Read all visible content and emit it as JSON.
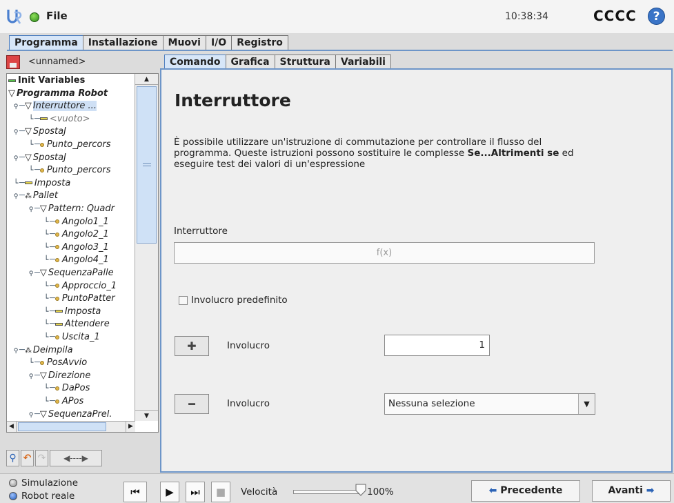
{
  "topbar": {
    "file_label": "File",
    "clock": "10:38:34",
    "robot_name": "CCCC",
    "help_glyph": "?"
  },
  "main_tabs": [
    "Programma",
    "Installazione",
    "Muovi",
    "I/O",
    "Registro"
  ],
  "main_tab_active": "Programma",
  "program": {
    "file_name": "<unnamed>",
    "tree": [
      {
        "label": "Init Variables",
        "indent": 0,
        "glyph": "bar-green",
        "style": "bold"
      },
      {
        "label": "Programma Robot",
        "indent": 0,
        "glyph": "triangle",
        "style": "boldital"
      },
      {
        "label": "Interruttore ...",
        "indent": 1,
        "glyph": "triangle",
        "style": "selected"
      },
      {
        "label": "<vuoto>",
        "indent": 2,
        "glyph": "bar",
        "style": "muted"
      },
      {
        "label": "SpostaJ",
        "indent": 1,
        "glyph": "triangle",
        "style": ""
      },
      {
        "label": "Punto_percors",
        "indent": 2,
        "glyph": "dot",
        "style": ""
      },
      {
        "label": "SpostaJ",
        "indent": 1,
        "glyph": "triangle",
        "style": ""
      },
      {
        "label": "Punto_percors",
        "indent": 2,
        "glyph": "dot",
        "style": ""
      },
      {
        "label": "Imposta",
        "indent": 1,
        "glyph": "bar",
        "style": ""
      },
      {
        "label": "Pallet",
        "indent": 1,
        "glyph": "pallet",
        "style": ""
      },
      {
        "label": "Pattern: Quadr",
        "indent": 2,
        "glyph": "triangle",
        "style": ""
      },
      {
        "label": "Angolo1_1",
        "indent": 3,
        "glyph": "dot",
        "style": ""
      },
      {
        "label": "Angolo2_1",
        "indent": 3,
        "glyph": "dot",
        "style": ""
      },
      {
        "label": "Angolo3_1",
        "indent": 3,
        "glyph": "dot",
        "style": ""
      },
      {
        "label": "Angolo4_1",
        "indent": 3,
        "glyph": "dot",
        "style": ""
      },
      {
        "label": "SequenzaPalle",
        "indent": 2,
        "glyph": "triangle",
        "style": ""
      },
      {
        "label": "Approccio_1",
        "indent": 3,
        "glyph": "dot",
        "style": ""
      },
      {
        "label": "PuntoPatter",
        "indent": 3,
        "glyph": "dot",
        "style": ""
      },
      {
        "label": "Imposta",
        "indent": 3,
        "glyph": "bar",
        "style": ""
      },
      {
        "label": "Attendere",
        "indent": 3,
        "glyph": "bar",
        "style": ""
      },
      {
        "label": "Uscita_1",
        "indent": 3,
        "glyph": "dot",
        "style": ""
      },
      {
        "label": "Deimpila",
        "indent": 1,
        "glyph": "pallet",
        "style": ""
      },
      {
        "label": "PosAvvio",
        "indent": 2,
        "glyph": "dot",
        "style": ""
      },
      {
        "label": "Direzione",
        "indent": 2,
        "glyph": "triangle",
        "style": ""
      },
      {
        "label": "DaPos",
        "indent": 3,
        "glyph": "dot",
        "style": ""
      },
      {
        "label": "APos",
        "indent": 3,
        "glyph": "dot",
        "style": ""
      },
      {
        "label": "SequenzaPrel.",
        "indent": 2,
        "glyph": "triangle",
        "style": ""
      }
    ]
  },
  "sub_tabs": [
    "Comando",
    "Grafica",
    "Struttura",
    "Variabili"
  ],
  "sub_tab_active": "Comando",
  "command": {
    "title": "Interruttore",
    "description_html_parts": [
      "È possibile utilizzare un'istruzione di commutazione per controllare il flusso del programma. Queste istruzioni possono sostituire le complesse ",
      "Se...Altrimenti se",
      " ed eseguire test dei valori di un'espressione"
    ],
    "switch_label": "Interruttore",
    "expression_placeholder": "f(x)",
    "default_case_label": "Involucro predefinito",
    "add_case_label": "Involucro",
    "case_value": "1",
    "remove_case_label": "Involucro",
    "case_select_value": "Nessuna selezione"
  },
  "footer": {
    "mode_simulation": "Simulazione",
    "mode_real": "Robot reale",
    "speed_label": "Velocità",
    "speed_percent": 100,
    "speed_value": "100%",
    "prev_label": "Precedente",
    "next_label": "Avanti"
  },
  "colors": {
    "accent": "#6d95c8",
    "active_tab": "#d7e6f8",
    "status_ok": "#2e8a1c",
    "help": "#3a74c7"
  }
}
